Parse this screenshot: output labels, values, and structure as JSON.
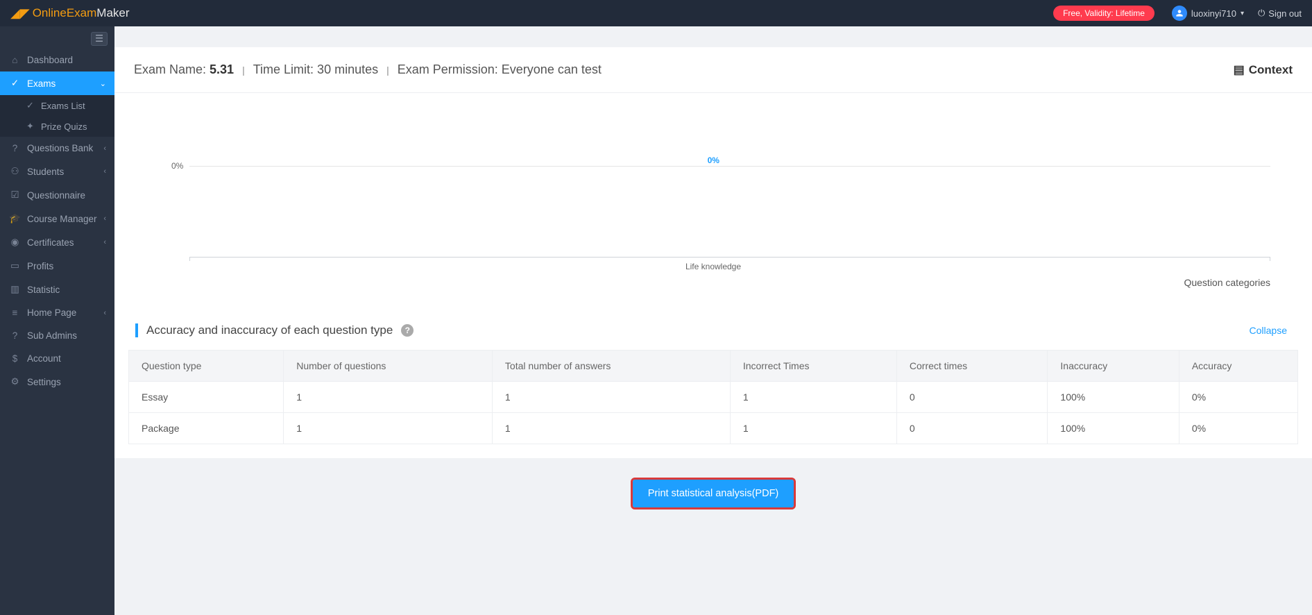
{
  "topbar": {
    "logo_online": "Online",
    "logo_exam": "Exam",
    "logo_maker": "Maker",
    "badge": "Free, Validity: Lifetime",
    "username": "luoxinyi710",
    "signout": "Sign out"
  },
  "sidebar": {
    "dashboard": "Dashboard",
    "exams": "Exams",
    "exams_list": "Exams List",
    "prize_quizs": "Prize Quizs",
    "questions_bank": "Questions Bank",
    "students": "Students",
    "questionnaire": "Questionnaire",
    "course_manager": "Course Manager",
    "certificates": "Certificates",
    "profits": "Profits",
    "statistic": "Statistic",
    "home_page": "Home Page",
    "sub_admins": "Sub Admins",
    "account": "Account",
    "settings": "Settings"
  },
  "header": {
    "exam_name_label": "Exam Name: ",
    "exam_name_value": "5.31",
    "time_limit": "Time Limit: 30 minutes",
    "permission": "Exam Permission: Everyone can test",
    "context": "Context"
  },
  "chart_data": {
    "type": "bar",
    "categories": [
      "Life knowledge"
    ],
    "values": [
      0
    ],
    "ylabel": "",
    "xlabel": "Question categories",
    "ylim": [
      0,
      100
    ],
    "unit": "%",
    "ytick_label": "0%",
    "bar_label": "0%",
    "xcat_label": "Life knowledge",
    "xtitle": "Question categories"
  },
  "section": {
    "title": "Accuracy and inaccuracy of each question type",
    "collapse": "Collapse"
  },
  "table": {
    "headers": {
      "qtype": "Question type",
      "numq": "Number of questions",
      "total": "Total number of answers",
      "incorrect": "Incorrect Times",
      "correct": "Correct times",
      "inaccuracy": "Inaccuracy",
      "accuracy": "Accuracy"
    },
    "rows": [
      {
        "qtype": "Essay",
        "numq": "1",
        "total": "1",
        "incorrect": "1",
        "correct": "0",
        "inaccuracy": "100%",
        "accuracy": "0%"
      },
      {
        "qtype": "Package",
        "numq": "1",
        "total": "1",
        "incorrect": "1",
        "correct": "0",
        "inaccuracy": "100%",
        "accuracy": "0%"
      }
    ]
  },
  "print_button": "Print statistical analysis(PDF)"
}
